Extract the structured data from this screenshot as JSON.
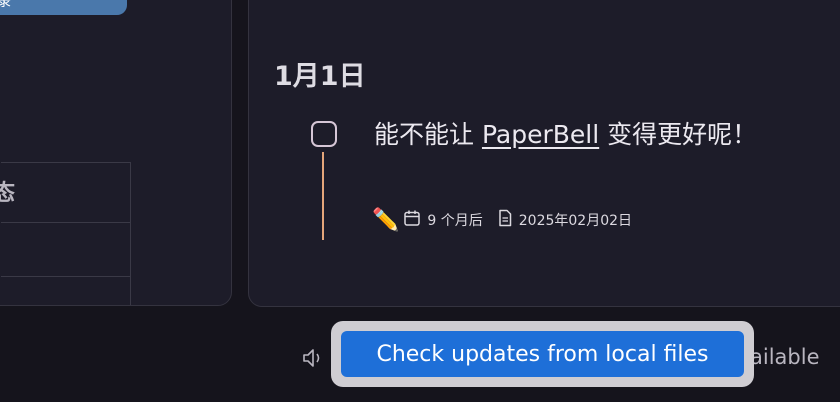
{
  "left_panel": {
    "pill_text": "录",
    "table": {
      "header_status": "态"
    }
  },
  "right_panel": {
    "date_heading": "1月1日",
    "task": {
      "title_prefix": "能不能让 ",
      "title_link": "PaperBell",
      "title_suffix": " 变得更好呢！",
      "pencil_emoji": "✏️",
      "due_text": "9 个月后",
      "created_text": "2025年02月02日"
    }
  },
  "status_bar": {
    "button_label": "Check updates from local files",
    "available_text": "ailable"
  },
  "icons": {
    "calendar": "calendar-icon",
    "document": "document-icon",
    "speaker": "speaker-icon",
    "pencil": "pencil-icon"
  },
  "colors": {
    "background": "#15141c",
    "panel": "#1d1c29",
    "accent_button": "#1e6fd8",
    "timeline": "#e4a57a",
    "pill": "#4a78ab"
  }
}
